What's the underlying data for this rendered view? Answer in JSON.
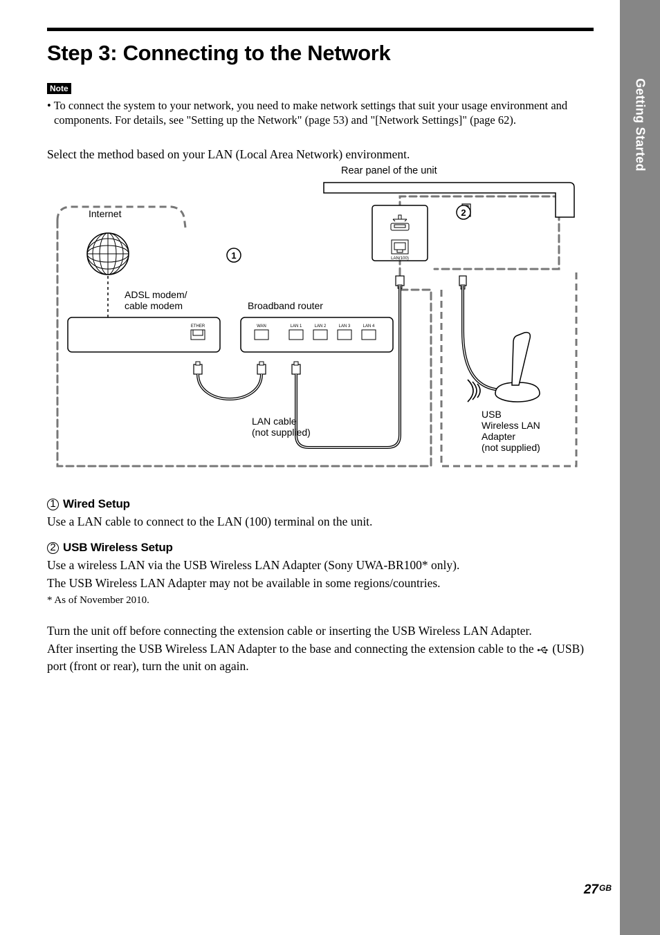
{
  "side_tab": "Getting Started",
  "heading": "Step 3: Connecting to the Network",
  "note_label": "Note",
  "note_text": "• To connect the system to your network, you need to make network settings that suit your usage environment and components. For details, see \"Setting up the Network\" (page 53) and \"[Network Settings]\" (page 62).",
  "intro": "Select the method based on your LAN (Local Area Network) environment.",
  "diagram": {
    "top_caption": "Rear panel of the unit",
    "callout_1": "1",
    "callout_2": "2",
    "internet": "Internet",
    "modem_l1": "ADSL modem/",
    "modem_l2": "cable modem",
    "router": "Broadband router",
    "lan_cable_l1": "LAN cable",
    "lan_cable_l2": "(not supplied)",
    "usb_l1": "USB",
    "usb_l2": "Wireless LAN",
    "usb_l3": "Adapter",
    "usb_l4": "(not supplied)",
    "ports": {
      "ether": "ETHER",
      "wan": "WAN",
      "lan1": "LAN 1",
      "lan2": "LAN 2",
      "lan3": "LAN 3",
      "lan4": "LAN 4",
      "lan100": "LAN(100)"
    }
  },
  "wired": {
    "num": "1",
    "title": "Wired Setup",
    "text": "Use a LAN cable to connect to the LAN (100) terminal on the unit."
  },
  "usb": {
    "num": "2",
    "title": "USB Wireless Setup",
    "line1": "Use a wireless LAN via the USB Wireless LAN Adapter (Sony UWA-BR100* only).",
    "line2": "The USB Wireless LAN Adapter may not be available in some regions/countries.",
    "footnote": "*   As of November 2010."
  },
  "tail1": "Turn the unit off before connecting the extension cable or inserting the USB Wireless LAN Adapter.",
  "tail2_a": "After inserting the USB Wireless LAN Adapter to the base and connecting the extension cable to the ",
  "tail2_b": " (USB) port (front or rear), turn the unit on again.",
  "page_number": "27",
  "page_region": "GB"
}
